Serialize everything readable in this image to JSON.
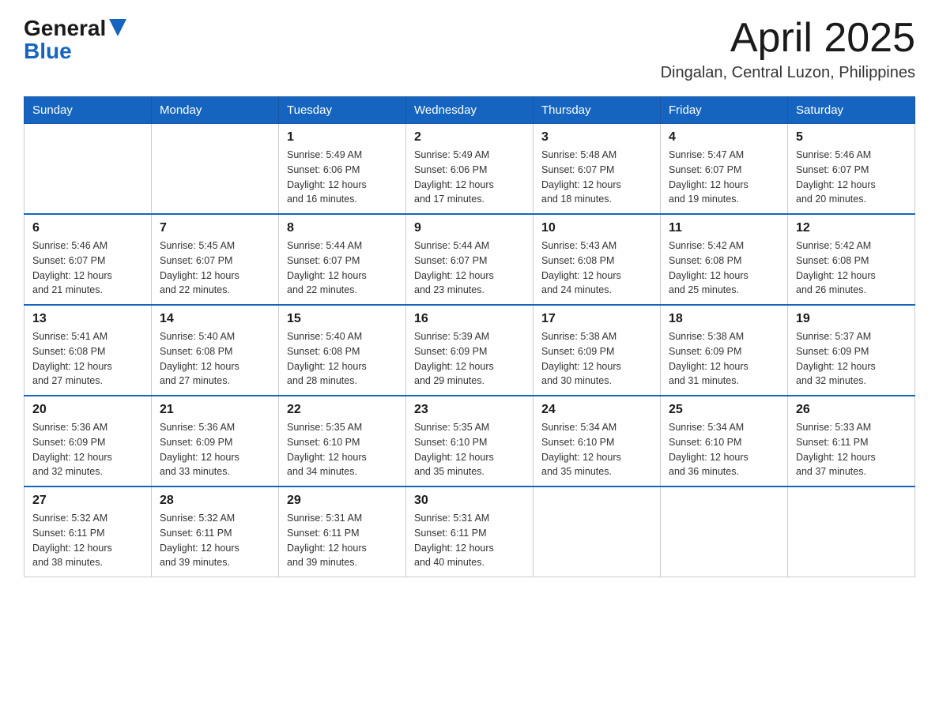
{
  "header": {
    "logo_general": "General",
    "logo_blue": "Blue",
    "month_title": "April 2025",
    "location": "Dingalan, Central Luzon, Philippines"
  },
  "calendar": {
    "days_of_week": [
      "Sunday",
      "Monday",
      "Tuesday",
      "Wednesday",
      "Thursday",
      "Friday",
      "Saturday"
    ],
    "weeks": [
      [
        {
          "day": "",
          "info": ""
        },
        {
          "day": "",
          "info": ""
        },
        {
          "day": "1",
          "info": "Sunrise: 5:49 AM\nSunset: 6:06 PM\nDaylight: 12 hours\nand 16 minutes."
        },
        {
          "day": "2",
          "info": "Sunrise: 5:49 AM\nSunset: 6:06 PM\nDaylight: 12 hours\nand 17 minutes."
        },
        {
          "day": "3",
          "info": "Sunrise: 5:48 AM\nSunset: 6:07 PM\nDaylight: 12 hours\nand 18 minutes."
        },
        {
          "day": "4",
          "info": "Sunrise: 5:47 AM\nSunset: 6:07 PM\nDaylight: 12 hours\nand 19 minutes."
        },
        {
          "day": "5",
          "info": "Sunrise: 5:46 AM\nSunset: 6:07 PM\nDaylight: 12 hours\nand 20 minutes."
        }
      ],
      [
        {
          "day": "6",
          "info": "Sunrise: 5:46 AM\nSunset: 6:07 PM\nDaylight: 12 hours\nand 21 minutes."
        },
        {
          "day": "7",
          "info": "Sunrise: 5:45 AM\nSunset: 6:07 PM\nDaylight: 12 hours\nand 22 minutes."
        },
        {
          "day": "8",
          "info": "Sunrise: 5:44 AM\nSunset: 6:07 PM\nDaylight: 12 hours\nand 22 minutes."
        },
        {
          "day": "9",
          "info": "Sunrise: 5:44 AM\nSunset: 6:07 PM\nDaylight: 12 hours\nand 23 minutes."
        },
        {
          "day": "10",
          "info": "Sunrise: 5:43 AM\nSunset: 6:08 PM\nDaylight: 12 hours\nand 24 minutes."
        },
        {
          "day": "11",
          "info": "Sunrise: 5:42 AM\nSunset: 6:08 PM\nDaylight: 12 hours\nand 25 minutes."
        },
        {
          "day": "12",
          "info": "Sunrise: 5:42 AM\nSunset: 6:08 PM\nDaylight: 12 hours\nand 26 minutes."
        }
      ],
      [
        {
          "day": "13",
          "info": "Sunrise: 5:41 AM\nSunset: 6:08 PM\nDaylight: 12 hours\nand 27 minutes."
        },
        {
          "day": "14",
          "info": "Sunrise: 5:40 AM\nSunset: 6:08 PM\nDaylight: 12 hours\nand 27 minutes."
        },
        {
          "day": "15",
          "info": "Sunrise: 5:40 AM\nSunset: 6:08 PM\nDaylight: 12 hours\nand 28 minutes."
        },
        {
          "day": "16",
          "info": "Sunrise: 5:39 AM\nSunset: 6:09 PM\nDaylight: 12 hours\nand 29 minutes."
        },
        {
          "day": "17",
          "info": "Sunrise: 5:38 AM\nSunset: 6:09 PM\nDaylight: 12 hours\nand 30 minutes."
        },
        {
          "day": "18",
          "info": "Sunrise: 5:38 AM\nSunset: 6:09 PM\nDaylight: 12 hours\nand 31 minutes."
        },
        {
          "day": "19",
          "info": "Sunrise: 5:37 AM\nSunset: 6:09 PM\nDaylight: 12 hours\nand 32 minutes."
        }
      ],
      [
        {
          "day": "20",
          "info": "Sunrise: 5:36 AM\nSunset: 6:09 PM\nDaylight: 12 hours\nand 32 minutes."
        },
        {
          "day": "21",
          "info": "Sunrise: 5:36 AM\nSunset: 6:09 PM\nDaylight: 12 hours\nand 33 minutes."
        },
        {
          "day": "22",
          "info": "Sunrise: 5:35 AM\nSunset: 6:10 PM\nDaylight: 12 hours\nand 34 minutes."
        },
        {
          "day": "23",
          "info": "Sunrise: 5:35 AM\nSunset: 6:10 PM\nDaylight: 12 hours\nand 35 minutes."
        },
        {
          "day": "24",
          "info": "Sunrise: 5:34 AM\nSunset: 6:10 PM\nDaylight: 12 hours\nand 35 minutes."
        },
        {
          "day": "25",
          "info": "Sunrise: 5:34 AM\nSunset: 6:10 PM\nDaylight: 12 hours\nand 36 minutes."
        },
        {
          "day": "26",
          "info": "Sunrise: 5:33 AM\nSunset: 6:11 PM\nDaylight: 12 hours\nand 37 minutes."
        }
      ],
      [
        {
          "day": "27",
          "info": "Sunrise: 5:32 AM\nSunset: 6:11 PM\nDaylight: 12 hours\nand 38 minutes."
        },
        {
          "day": "28",
          "info": "Sunrise: 5:32 AM\nSunset: 6:11 PM\nDaylight: 12 hours\nand 39 minutes."
        },
        {
          "day": "29",
          "info": "Sunrise: 5:31 AM\nSunset: 6:11 PM\nDaylight: 12 hours\nand 39 minutes."
        },
        {
          "day": "30",
          "info": "Sunrise: 5:31 AM\nSunset: 6:11 PM\nDaylight: 12 hours\nand 40 minutes."
        },
        {
          "day": "",
          "info": ""
        },
        {
          "day": "",
          "info": ""
        },
        {
          "day": "",
          "info": ""
        }
      ]
    ]
  }
}
